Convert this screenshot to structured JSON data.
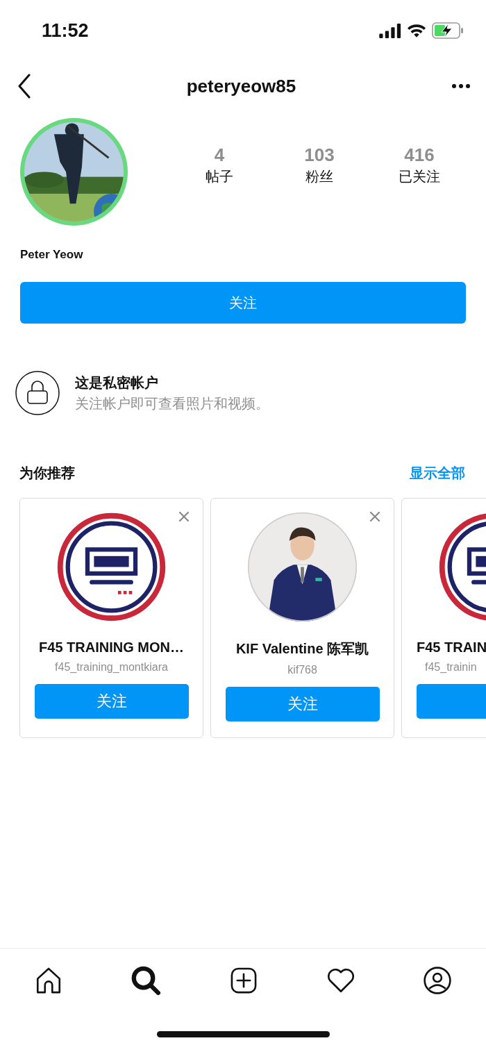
{
  "status_bar": {
    "time": "11:52"
  },
  "header": {
    "username": "peteryeow85"
  },
  "profile": {
    "stats": [
      {
        "value": "4",
        "label": "帖子"
      },
      {
        "value": "103",
        "label": "粉丝"
      },
      {
        "value": "416",
        "label": "已关注"
      }
    ],
    "name": "Peter Yeow",
    "follow_button": "关注"
  },
  "private_notice": {
    "title": "这是私密帐户",
    "subtitle": "关注帐户即可查看照片和视频。"
  },
  "suggestions": {
    "title": "为你推荐",
    "see_all": "显示全部",
    "cards": [
      {
        "kind": "full",
        "name": "F45 TRAINING MON…",
        "handle": "f45_training_montkiara",
        "button": "关注"
      },
      {
        "kind": "full",
        "name": "KIF Valentine 陈军凯",
        "handle": "kif768",
        "button": "关注"
      },
      {
        "kind": "cut",
        "name": "F45 TRAIN",
        "handle": "f45_trainin"
      }
    ]
  },
  "bottom_nav": {
    "items": [
      {
        "kind": "home",
        "selected": false
      },
      {
        "kind": "search",
        "selected": true
      },
      {
        "kind": "add",
        "selected": false
      },
      {
        "kind": "heart",
        "selected": false
      },
      {
        "kind": "profile",
        "selected": false
      }
    ]
  }
}
